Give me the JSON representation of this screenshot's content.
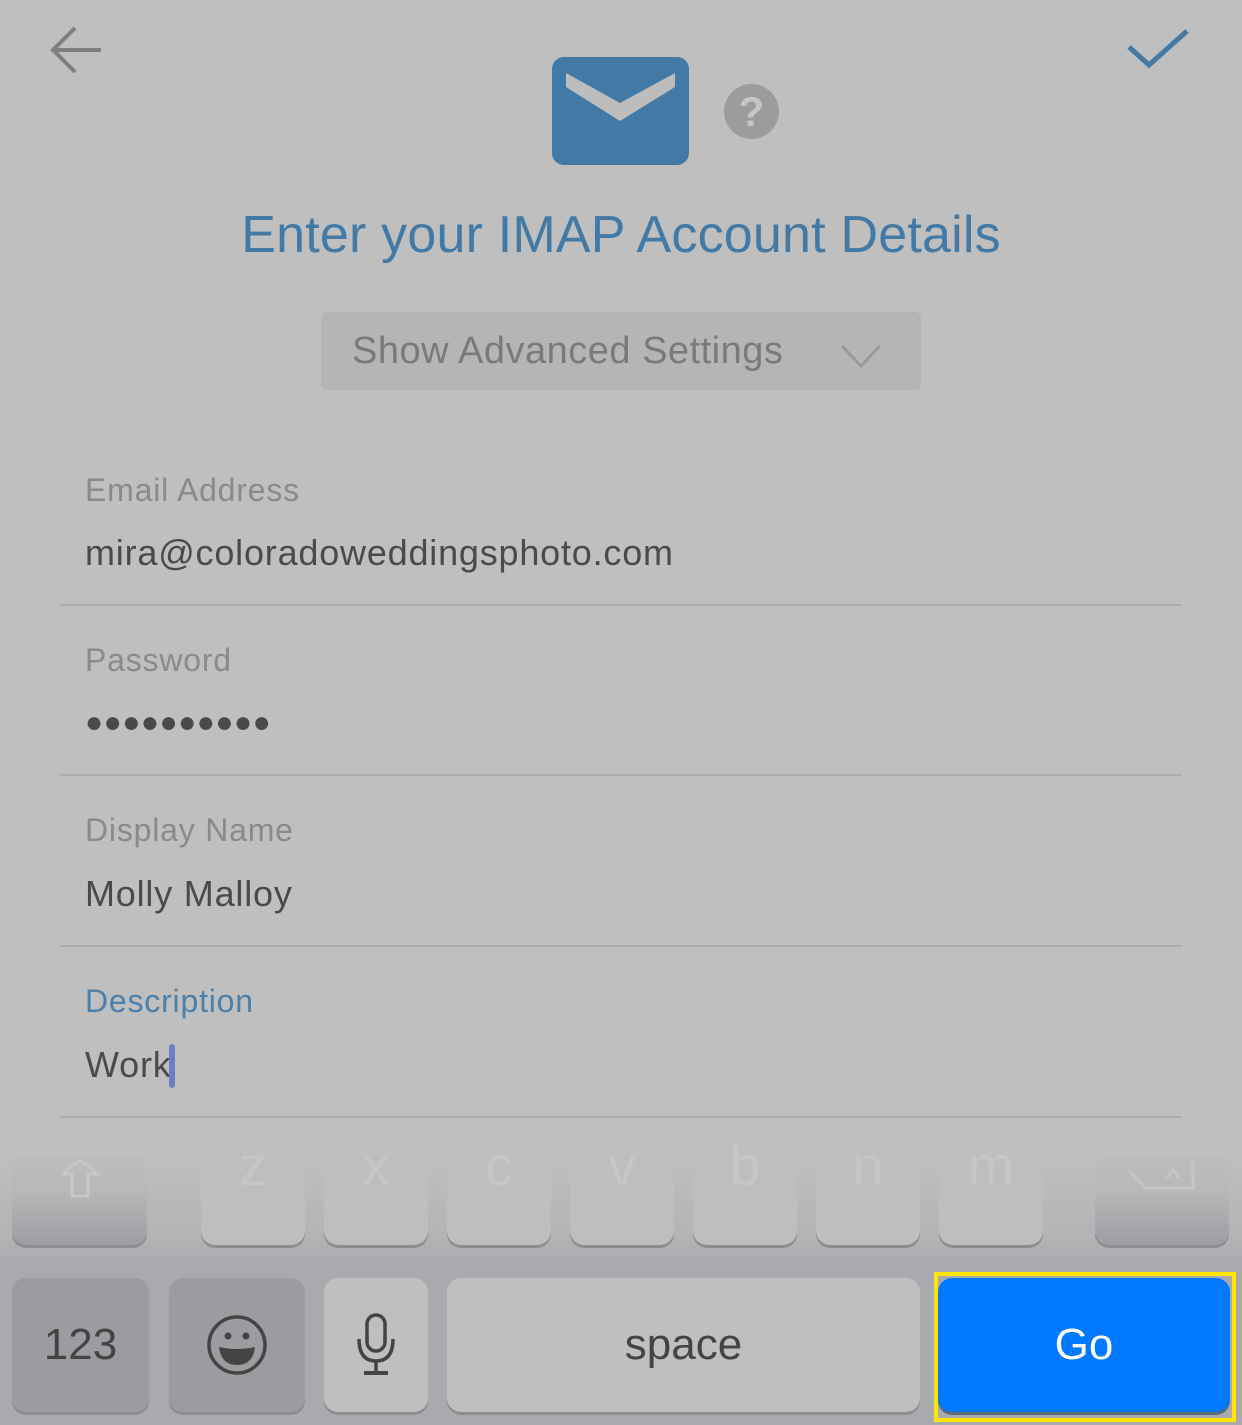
{
  "header": {
    "back_icon": "arrow-left-icon",
    "done_icon": "checkmark-icon",
    "mail_icon": "envelope-icon",
    "help_icon": "question-circle-icon",
    "help_glyph": "?",
    "title": "Enter your IMAP Account Details"
  },
  "advanced": {
    "label": "Show Advanced Settings",
    "icon": "chevron-down-icon"
  },
  "form": {
    "fields": [
      {
        "label": "Email Address",
        "value": "mira@coloradoweddingsphoto.com",
        "active": false
      },
      {
        "label": "Password",
        "value": "●●●●●●●●●●",
        "active": false
      },
      {
        "label": "Display Name",
        "value": "Molly Malloy",
        "active": false
      },
      {
        "label": "Description",
        "value": "Work",
        "active": true
      }
    ]
  },
  "keyboard": {
    "row3": [
      "z",
      "x",
      "c",
      "v",
      "b",
      "n",
      "m"
    ],
    "shift_icon": "shift-icon",
    "delete_icon": "backspace-icon",
    "numbers_label": "123",
    "emoji_icon": "emoji-icon",
    "mic_icon": "microphone-icon",
    "space_label": "space",
    "go_label": "Go"
  },
  "colors": {
    "accent": "#4279a5",
    "go_button": "#0078ff",
    "highlight": "#ffe600",
    "caret": "#6a7fc6"
  }
}
